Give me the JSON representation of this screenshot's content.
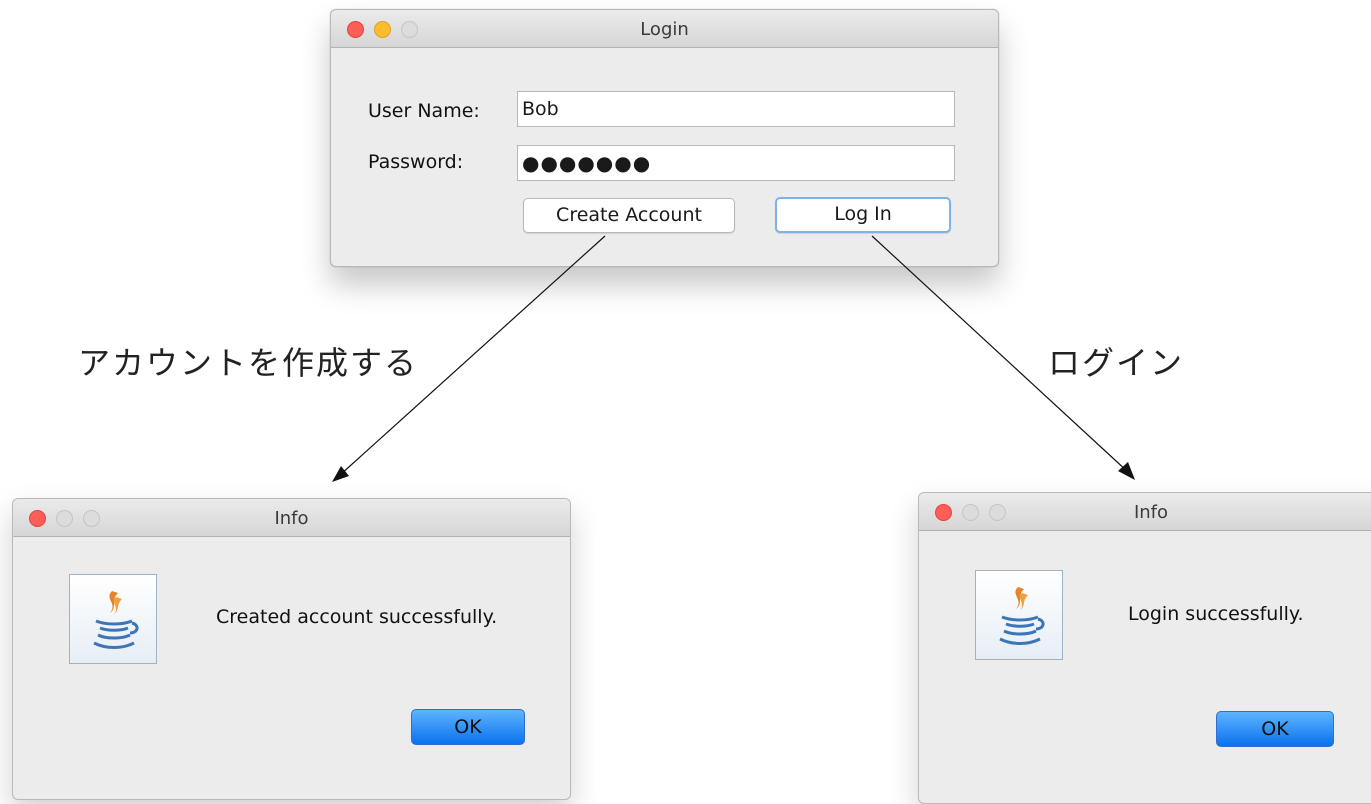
{
  "login_window": {
    "title": "Login",
    "username_label": "User Name:",
    "username_value": "Bob",
    "password_label": "Password:",
    "password_value": "●●●●●●●",
    "create_account_label": "Create Account",
    "login_label": "Log In"
  },
  "annotations": {
    "create_account": "アカウントを作成する",
    "login": "ログイン"
  },
  "info_dialog_create": {
    "title": "Info",
    "message": "Created account successfully.",
    "ok_label": "OK"
  },
  "info_dialog_login": {
    "title": "Info",
    "message": "Login successfully.",
    "ok_label": "OK"
  },
  "colors": {
    "close": "#fd5f57",
    "minimize": "#fdbb2e",
    "ok_button": "#0a72ee",
    "focus_ring": "#7eb3e8"
  }
}
